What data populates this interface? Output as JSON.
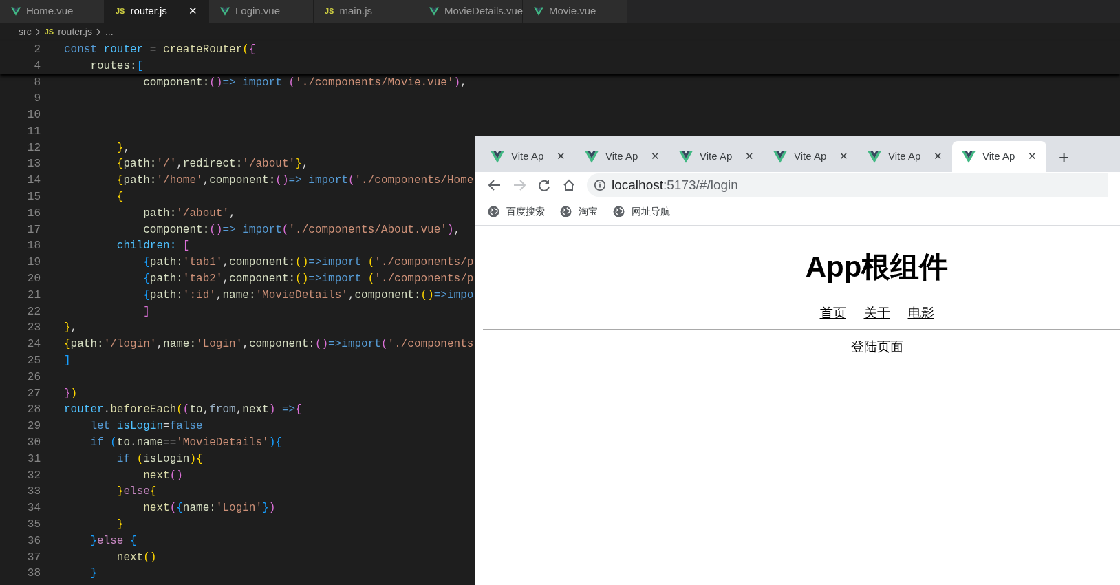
{
  "editor": {
    "tabs": [
      {
        "label": "Home.vue",
        "kind": "vue",
        "selected": false
      },
      {
        "label": "router.js",
        "kind": "js",
        "badge": "JS",
        "selected": true,
        "close": "✕"
      },
      {
        "label": "Login.vue",
        "kind": "vue",
        "selected": false
      },
      {
        "label": "main.js",
        "kind": "js",
        "badge": "JS",
        "selected": false
      },
      {
        "label": "MovieDetails.vue",
        "kind": "vue",
        "selected": false
      },
      {
        "label": "Movie.vue",
        "kind": "vue",
        "selected": false
      }
    ],
    "breadcrumb": {
      "folder": "src",
      "file": "router.js",
      "kind": "js",
      "badge": "JS",
      "more": "..."
    },
    "sticky_lines": [
      {
        "number": "2",
        "tokens": [
          {
            "kind": "kw",
            "text": "const "
          },
          {
            "kind": "var",
            "text": "router"
          },
          {
            "kind": "p",
            "text": " = "
          },
          {
            "kind": "fn",
            "text": "createRouter"
          },
          {
            "kind": "b1",
            "text": "("
          },
          {
            "kind": "b2",
            "text": "{"
          }
        ]
      },
      {
        "number": "4",
        "tokens": [
          {
            "kind": "prop",
            "text": "    routes:"
          },
          {
            "kind": "b3",
            "text": "["
          }
        ]
      }
    ],
    "lines": [
      {
        "number": "8",
        "tokens": [
          {
            "kind": "prop",
            "text": "            component:"
          },
          {
            "kind": "b2",
            "text": "()"
          },
          {
            "kind": "kw",
            "text": "=> import "
          },
          {
            "kind": "b2",
            "text": "("
          },
          {
            "kind": "str",
            "text": "'./components/Movie.vue'"
          },
          {
            "kind": "b2",
            "text": ")"
          },
          {
            "kind": "p",
            "text": ","
          }
        ]
      },
      {
        "number": "9"
      },
      {
        "number": "10"
      },
      {
        "number": "11"
      },
      {
        "number": "12",
        "tokens": [
          {
            "kind": "b1",
            "text": "        }"
          },
          {
            "kind": "p",
            "text": ","
          }
        ]
      },
      {
        "number": "13",
        "tokens": [
          {
            "kind": "b1",
            "text": "        {"
          },
          {
            "kind": "prop",
            "text": "path:"
          },
          {
            "kind": "str",
            "text": "'/'"
          },
          {
            "kind": "p",
            "text": ","
          },
          {
            "kind": "prop",
            "text": "redirect:"
          },
          {
            "kind": "str",
            "text": "'/about'"
          },
          {
            "kind": "b1",
            "text": "}"
          },
          {
            "kind": "p",
            "text": ","
          }
        ]
      },
      {
        "number": "14",
        "tokens": [
          {
            "kind": "b1",
            "text": "        {"
          },
          {
            "kind": "prop",
            "text": "path:"
          },
          {
            "kind": "str",
            "text": "'/home'"
          },
          {
            "kind": "p",
            "text": ","
          },
          {
            "kind": "prop",
            "text": "component:"
          },
          {
            "kind": "b2",
            "text": "()"
          },
          {
            "kind": "kw",
            "text": "=> import"
          },
          {
            "kind": "b2",
            "text": "("
          },
          {
            "kind": "str",
            "text": "'./components/Home"
          }
        ]
      },
      {
        "number": "15",
        "tokens": [
          {
            "kind": "b1",
            "text": "        {"
          }
        ]
      },
      {
        "number": "16",
        "tokens": [
          {
            "kind": "prop",
            "text": "            path:"
          },
          {
            "kind": "str",
            "text": "'/about'"
          },
          {
            "kind": "p",
            "text": ","
          }
        ]
      },
      {
        "number": "17",
        "tokens": [
          {
            "kind": "prop",
            "text": "            component:"
          },
          {
            "kind": "b2",
            "text": "()"
          },
          {
            "kind": "kw",
            "text": "=> import"
          },
          {
            "kind": "b2",
            "text": "("
          },
          {
            "kind": "str",
            "text": "'./components/About.vue'"
          },
          {
            "kind": "b2",
            "text": ")"
          },
          {
            "kind": "p",
            "text": ","
          }
        ]
      },
      {
        "number": "18",
        "tokens": [
          {
            "kind": "var",
            "text": "        children: "
          },
          {
            "kind": "b2",
            "text": "["
          }
        ]
      },
      {
        "number": "19",
        "tokens": [
          {
            "kind": "b3",
            "text": "            {"
          },
          {
            "kind": "prop",
            "text": "path:"
          },
          {
            "kind": "str",
            "text": "'tab1'"
          },
          {
            "kind": "p",
            "text": ","
          },
          {
            "kind": "prop",
            "text": "component:"
          },
          {
            "kind": "b1",
            "text": "()"
          },
          {
            "kind": "kw",
            "text": "=>import "
          },
          {
            "kind": "b1",
            "text": "("
          },
          {
            "kind": "str",
            "text": "'./components/p"
          }
        ]
      },
      {
        "number": "20",
        "tokens": [
          {
            "kind": "b3",
            "text": "            {"
          },
          {
            "kind": "prop",
            "text": "path:"
          },
          {
            "kind": "str",
            "text": "'tab2'"
          },
          {
            "kind": "p",
            "text": ","
          },
          {
            "kind": "prop",
            "text": "component:"
          },
          {
            "kind": "b1",
            "text": "()"
          },
          {
            "kind": "kw",
            "text": "=>import "
          },
          {
            "kind": "b1",
            "text": "("
          },
          {
            "kind": "str",
            "text": "'./components/p"
          }
        ]
      },
      {
        "number": "21",
        "tokens": [
          {
            "kind": "b3",
            "text": "            {"
          },
          {
            "kind": "prop",
            "text": "path:"
          },
          {
            "kind": "str",
            "text": "':id'"
          },
          {
            "kind": "p",
            "text": ","
          },
          {
            "kind": "prop",
            "text": "name:"
          },
          {
            "kind": "str",
            "text": "'MovieDetails'"
          },
          {
            "kind": "p",
            "text": ","
          },
          {
            "kind": "prop",
            "text": "component:"
          },
          {
            "kind": "b1",
            "text": "()"
          },
          {
            "kind": "kw",
            "text": "=>impo"
          }
        ]
      },
      {
        "number": "22",
        "tokens": [
          {
            "kind": "b2",
            "text": "            ]"
          }
        ]
      },
      {
        "number": "23",
        "tokens": [
          {
            "kind": "b1",
            "text": "}"
          },
          {
            "kind": "p",
            "text": ","
          }
        ]
      },
      {
        "number": "24",
        "tokens": [
          {
            "kind": "b1",
            "text": "{"
          },
          {
            "kind": "prop",
            "text": "path:"
          },
          {
            "kind": "str",
            "text": "'/login'"
          },
          {
            "kind": "p",
            "text": ","
          },
          {
            "kind": "prop",
            "text": "name:"
          },
          {
            "kind": "str",
            "text": "'Login'"
          },
          {
            "kind": "p",
            "text": ","
          },
          {
            "kind": "prop",
            "text": "component:"
          },
          {
            "kind": "b2",
            "text": "()"
          },
          {
            "kind": "kw",
            "text": "=>import"
          },
          {
            "kind": "b2",
            "text": "("
          },
          {
            "kind": "str",
            "text": "'./components"
          }
        ]
      },
      {
        "number": "25",
        "tokens": [
          {
            "kind": "b3",
            "text": "]"
          }
        ]
      },
      {
        "number": "26"
      },
      {
        "number": "27",
        "tokens": [
          {
            "kind": "b2",
            "text": "}"
          },
          {
            "kind": "b1",
            "text": ")"
          }
        ]
      },
      {
        "number": "28",
        "tokens": [
          {
            "kind": "var",
            "text": "router"
          },
          {
            "kind": "p",
            "text": "."
          },
          {
            "kind": "fn",
            "text": "beforeEach"
          },
          {
            "kind": "b1",
            "text": "("
          },
          {
            "kind": "b2",
            "text": "("
          },
          {
            "kind": "prop",
            "text": "to"
          },
          {
            "kind": "p",
            "text": ","
          },
          {
            "kind": "param",
            "text": "from"
          },
          {
            "kind": "p",
            "text": ","
          },
          {
            "kind": "prop",
            "text": "next"
          },
          {
            "kind": "b2",
            "text": ")"
          },
          {
            "kind": "kw",
            "text": " =>"
          },
          {
            "kind": "b2",
            "text": "{"
          }
        ]
      },
      {
        "number": "29",
        "tokens": [
          {
            "kind": "kw",
            "text": "    let "
          },
          {
            "kind": "var",
            "text": "isLogin"
          },
          {
            "kind": "p",
            "text": "="
          },
          {
            "kind": "kw",
            "text": "false"
          }
        ]
      },
      {
        "number": "30",
        "tokens": [
          {
            "kind": "kw",
            "text": "    if "
          },
          {
            "kind": "b3",
            "text": "("
          },
          {
            "kind": "prop",
            "text": "to"
          },
          {
            "kind": "p",
            "text": "."
          },
          {
            "kind": "prop",
            "text": "name"
          },
          {
            "kind": "p",
            "text": "=="
          },
          {
            "kind": "str",
            "text": "'MovieDetails'"
          },
          {
            "kind": "b3",
            "text": "){"
          }
        ]
      },
      {
        "number": "31",
        "tokens": [
          {
            "kind": "kw",
            "text": "        if "
          },
          {
            "kind": "b1",
            "text": "("
          },
          {
            "kind": "prop",
            "text": "isLogin"
          },
          {
            "kind": "b1",
            "text": "){"
          }
        ]
      },
      {
        "number": "32",
        "tokens": [
          {
            "kind": "fn",
            "text": "            next"
          },
          {
            "kind": "b2",
            "text": "()"
          }
        ]
      },
      {
        "number": "33",
        "tokens": [
          {
            "kind": "b1",
            "text": "        }"
          },
          {
            "kind": "ctl",
            "text": "else"
          },
          {
            "kind": "b1",
            "text": "{"
          }
        ]
      },
      {
        "number": "34",
        "tokens": [
          {
            "kind": "fn",
            "text": "            next"
          },
          {
            "kind": "b2",
            "text": "("
          },
          {
            "kind": "b3",
            "text": "{"
          },
          {
            "kind": "prop",
            "text": "name:"
          },
          {
            "kind": "str",
            "text": "'Login'"
          },
          {
            "kind": "b3",
            "text": "}"
          },
          {
            "kind": "b2",
            "text": ")"
          }
        ]
      },
      {
        "number": "35",
        "tokens": [
          {
            "kind": "b1",
            "text": "        }"
          }
        ]
      },
      {
        "number": "36",
        "tokens": [
          {
            "kind": "b3",
            "text": "    }"
          },
          {
            "kind": "ctl",
            "text": "else "
          },
          {
            "kind": "b3",
            "text": "{"
          }
        ]
      },
      {
        "number": "37",
        "tokens": [
          {
            "kind": "fn",
            "text": "        next"
          },
          {
            "kind": "b1",
            "text": "()"
          }
        ]
      },
      {
        "number": "38",
        "tokens": [
          {
            "kind": "b3",
            "text": "    }"
          }
        ]
      }
    ]
  },
  "browser": {
    "tabs": [
      {
        "title": "Vite Ap",
        "close": "✕",
        "selected": false
      },
      {
        "title": "Vite Ap",
        "close": "✕",
        "selected": false
      },
      {
        "title": "Vite Ap",
        "close": "✕",
        "selected": false
      },
      {
        "title": "Vite Ap",
        "close": "✕",
        "selected": false
      },
      {
        "title": "Vite Ap",
        "close": "✕",
        "selected": false
      },
      {
        "title": "Vite Ap",
        "close": "✕",
        "selected": true
      }
    ],
    "new_tab": "+",
    "address": {
      "host": "localhost",
      "path": ":5173/#/login"
    },
    "bookmarks": [
      "百度搜索",
      "淘宝",
      "网址导航"
    ],
    "page": {
      "heading": "App根组件",
      "nav_links": [
        "首页",
        "关于",
        "电影"
      ],
      "content": "登陆页面"
    }
  }
}
